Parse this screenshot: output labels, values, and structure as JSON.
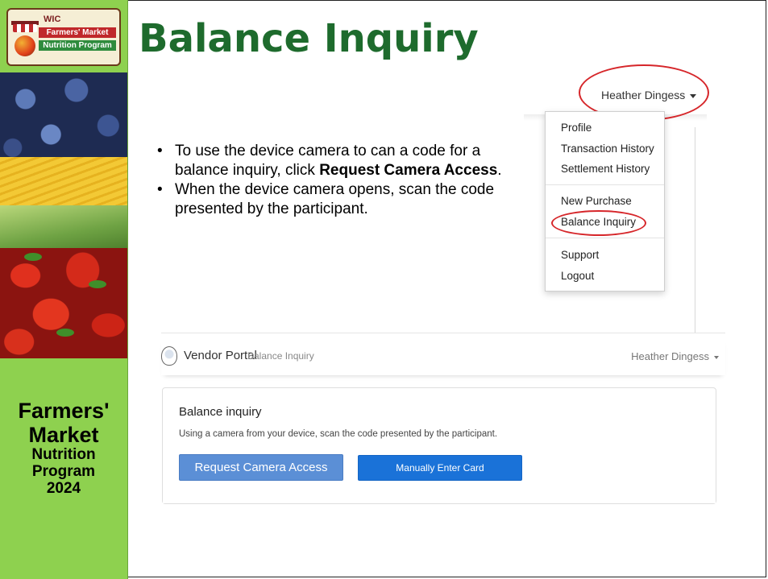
{
  "logo": {
    "tag": "WIC",
    "line1": "Farmers' Market",
    "line2": "Nutrition Program"
  },
  "sidebar": {
    "line1": "Farmers'",
    "line2": "Market",
    "line3": "Nutrition",
    "line4": "Program",
    "line5": "2024"
  },
  "slide": {
    "title": "Balance Inquiry",
    "bullet1_pre": "To use the device camera to can a code for a balance inquiry, click ",
    "bullet1_bold": "Request Camera Access",
    "bullet1_post": ".",
    "bullet2": "When the device camera opens, scan the code presented by the participant."
  },
  "dropdown": {
    "user": "Heather Dingess",
    "items": [
      "Profile",
      "Transaction History",
      "Settlement History",
      "New Purchase",
      "Balance Inquiry",
      "Support",
      "Logout"
    ]
  },
  "portal": {
    "brand": "Vendor Portal",
    "breadcrumb": "Balance Inquiry",
    "user": "Heather Dingess",
    "card_title": "Balance inquiry",
    "card_desc": "Using a camera from your device, scan the code presented by the participant.",
    "request_button": "Request Camera Access",
    "manual_button": "Manually Enter Card"
  },
  "colors": {
    "sidebar": "#8ed14f",
    "title": "#1e6b2d",
    "highlight": "#d6262a",
    "primary_button": "#5b8fd6",
    "secondary_button": "#1a72d8"
  }
}
